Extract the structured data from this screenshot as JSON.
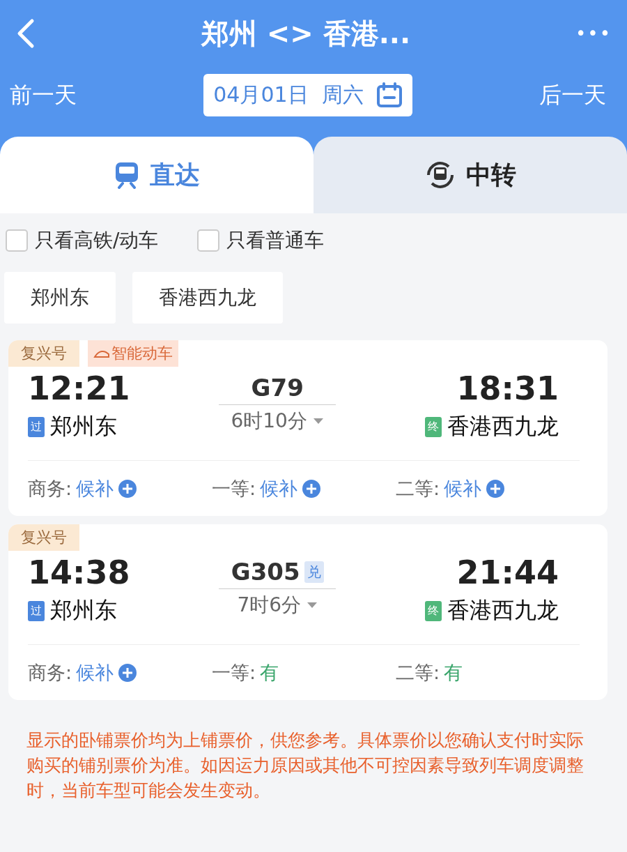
{
  "header": {
    "title": "郑州 <> 香港...",
    "more": "•••",
    "prev_day": "前一天",
    "date": "04月01日  周六",
    "next_day": "后一天"
  },
  "tabs": [
    {
      "label": "直达",
      "kind": "direct",
      "selected": true
    },
    {
      "label": "中转",
      "kind": "transfer",
      "selected": false
    }
  ],
  "filters": [
    {
      "label": "只看高铁/动车",
      "checked": false
    },
    {
      "label": "只看普通车",
      "checked": false
    }
  ],
  "stations": [
    "郑州东",
    "香港西九龙"
  ],
  "trains": [
    {
      "tags": [
        {
          "label": "复兴号",
          "kind": "plain"
        },
        {
          "label": "智能动车",
          "kind": "smart"
        }
      ],
      "depart": "12:21",
      "number": "G79",
      "duration": "6时10分",
      "arrive": "18:31",
      "from_badge": "过",
      "from": "郑州东",
      "to_badge": "终",
      "to": "香港西九龙",
      "seats": [
        {
          "class": "商务:",
          "status": "候补",
          "kind": "waitlist"
        },
        {
          "class": "一等:",
          "status": "候补",
          "kind": "waitlist"
        },
        {
          "class": "二等:",
          "status": "候补",
          "kind": "waitlist"
        }
      ]
    },
    {
      "tags": [
        {
          "label": "复兴号",
          "kind": "plain"
        }
      ],
      "depart": "14:38",
      "number": "G305",
      "exchange": "兑",
      "duration": "7时6分",
      "arrive": "21:44",
      "from_badge": "过",
      "from": "郑州东",
      "to_badge": "终",
      "to": "香港西九龙",
      "seats": [
        {
          "class": "商务:",
          "status": "候补",
          "kind": "waitlist"
        },
        {
          "class": "一等:",
          "status": "有",
          "kind": "available"
        },
        {
          "class": "二等:",
          "status": "有",
          "kind": "available"
        }
      ]
    }
  ],
  "notice": "显示的卧铺票价均为上铺票价，供您参考。具体票价以您确认支付时实际购买的铺别票价为准。如因运力原因或其他不可控因素导致列车调度调整时，当前车型可能会发生变动。"
}
